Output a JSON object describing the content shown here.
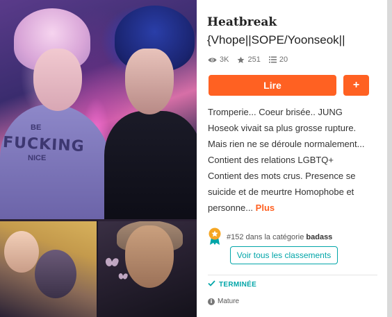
{
  "story": {
    "title_line1": "Heatbreak",
    "title_line2": "{Vhope||SOPE/Yoonseok||",
    "stats": {
      "reads": "3K",
      "votes": "251",
      "parts": "20"
    },
    "read_button": "Lire",
    "add_button": "+",
    "description_lines": [
      "Tromperie... Coeur brisée.. JUNG",
      "Hoseok vivait sa plus grosse rupture.",
      "Mais rien ne se déroule normalement...",
      "Contient des relations LGBTQ+",
      "Contient des mots crus. Presence se",
      "suicide et de meurtre Homophobe et"
    ],
    "description_last": "personne...",
    "more_link": "Plus",
    "ranking": {
      "rank": "#152",
      "text": "dans la catégorie",
      "category": "badass",
      "button": "Voir tous les classements"
    },
    "status": "TERMINÉE",
    "mature": "Mature"
  },
  "cover": {
    "hoodie_text": "FUCKING",
    "hoodie_sub": "NICE",
    "hoodie_top": "BE"
  },
  "colors": {
    "accent": "#ff6122",
    "teal": "#00a5a8",
    "badge": "#f5a623"
  },
  "icons": {
    "reads": "eye-icon",
    "votes": "star-icon",
    "parts": "list-icon",
    "status": "check-icon",
    "mature": "info-icon",
    "ranking": "ribbon-badge-icon"
  }
}
